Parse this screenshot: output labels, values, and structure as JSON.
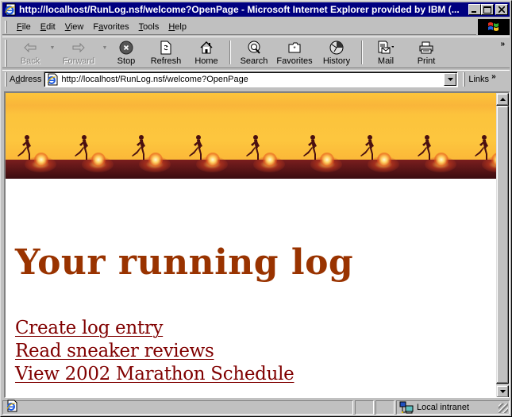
{
  "window": {
    "title": "http://localhost/RunLog.nsf/welcome?OpenPage - Microsoft Internet Explorer provided by IBM (...",
    "controls": {
      "minimize": "_",
      "maximize": "□",
      "close": "×"
    }
  },
  "menu": {
    "items": [
      {
        "label": "File",
        "accel": "F",
        "rest": "ile"
      },
      {
        "label": "Edit",
        "accel": "E",
        "rest": "dit"
      },
      {
        "label": "View",
        "accel": "V",
        "rest": "iew"
      },
      {
        "label": "Favorites",
        "pre": "F",
        "accel": "a",
        "rest": "vorites"
      },
      {
        "label": "Tools",
        "accel": "T",
        "rest": "ools"
      },
      {
        "label": "Help",
        "accel": "H",
        "rest": "elp"
      }
    ]
  },
  "toolbar": {
    "back": "Back",
    "forward": "Forward",
    "stop": "Stop",
    "refresh": "Refresh",
    "home": "Home",
    "search": "Search",
    "favorites": "Favorites",
    "history": "History",
    "mail": "Mail",
    "print": "Print",
    "more": "»"
  },
  "address": {
    "label_pre": "A",
    "label_accel": "d",
    "label_rest": "dress",
    "url": "http://localhost/RunLog.nsf/welcome?OpenPage",
    "links_label": "Links",
    "links_more": "»"
  },
  "page": {
    "banner_tiles": 9,
    "heading": "Your running log",
    "links": [
      "Create log entry",
      "Read sneaker reviews",
      "View 2002 Marathon Schedule"
    ],
    "colors": {
      "heading": "#993300",
      "link": "#800000",
      "titlebar": "#000080"
    }
  },
  "status": {
    "text": "",
    "zone": "Local intranet"
  }
}
